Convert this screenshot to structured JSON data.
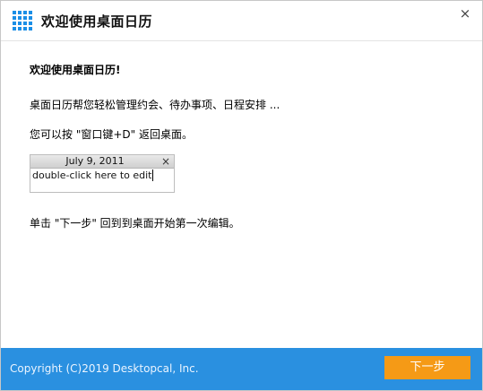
{
  "window": {
    "title": "欢迎使用桌面日历",
    "close_symbol": "×",
    "icon": "calendar-grid-icon",
    "accent": "#1a8ee6"
  },
  "content": {
    "heading": "欢迎使用桌面日历!",
    "line1": "桌面日历帮您轻松管理约会、待办事项、日程安排 ...",
    "line2": "您可以按 \"窗口键+D\" 返回桌面。",
    "line3": "单击 \"下一步\" 回到到桌面开始第一次编辑。"
  },
  "mini_calendar": {
    "date": "July 9, 2011",
    "close_symbol": "×",
    "edit_text": "double-click here to edit"
  },
  "footer": {
    "copyright": "Copyright (C)2019 Desktopcal, Inc.",
    "next_label": "下一步",
    "bar_color": "#2a90e0",
    "button_color": "#f59a16"
  }
}
